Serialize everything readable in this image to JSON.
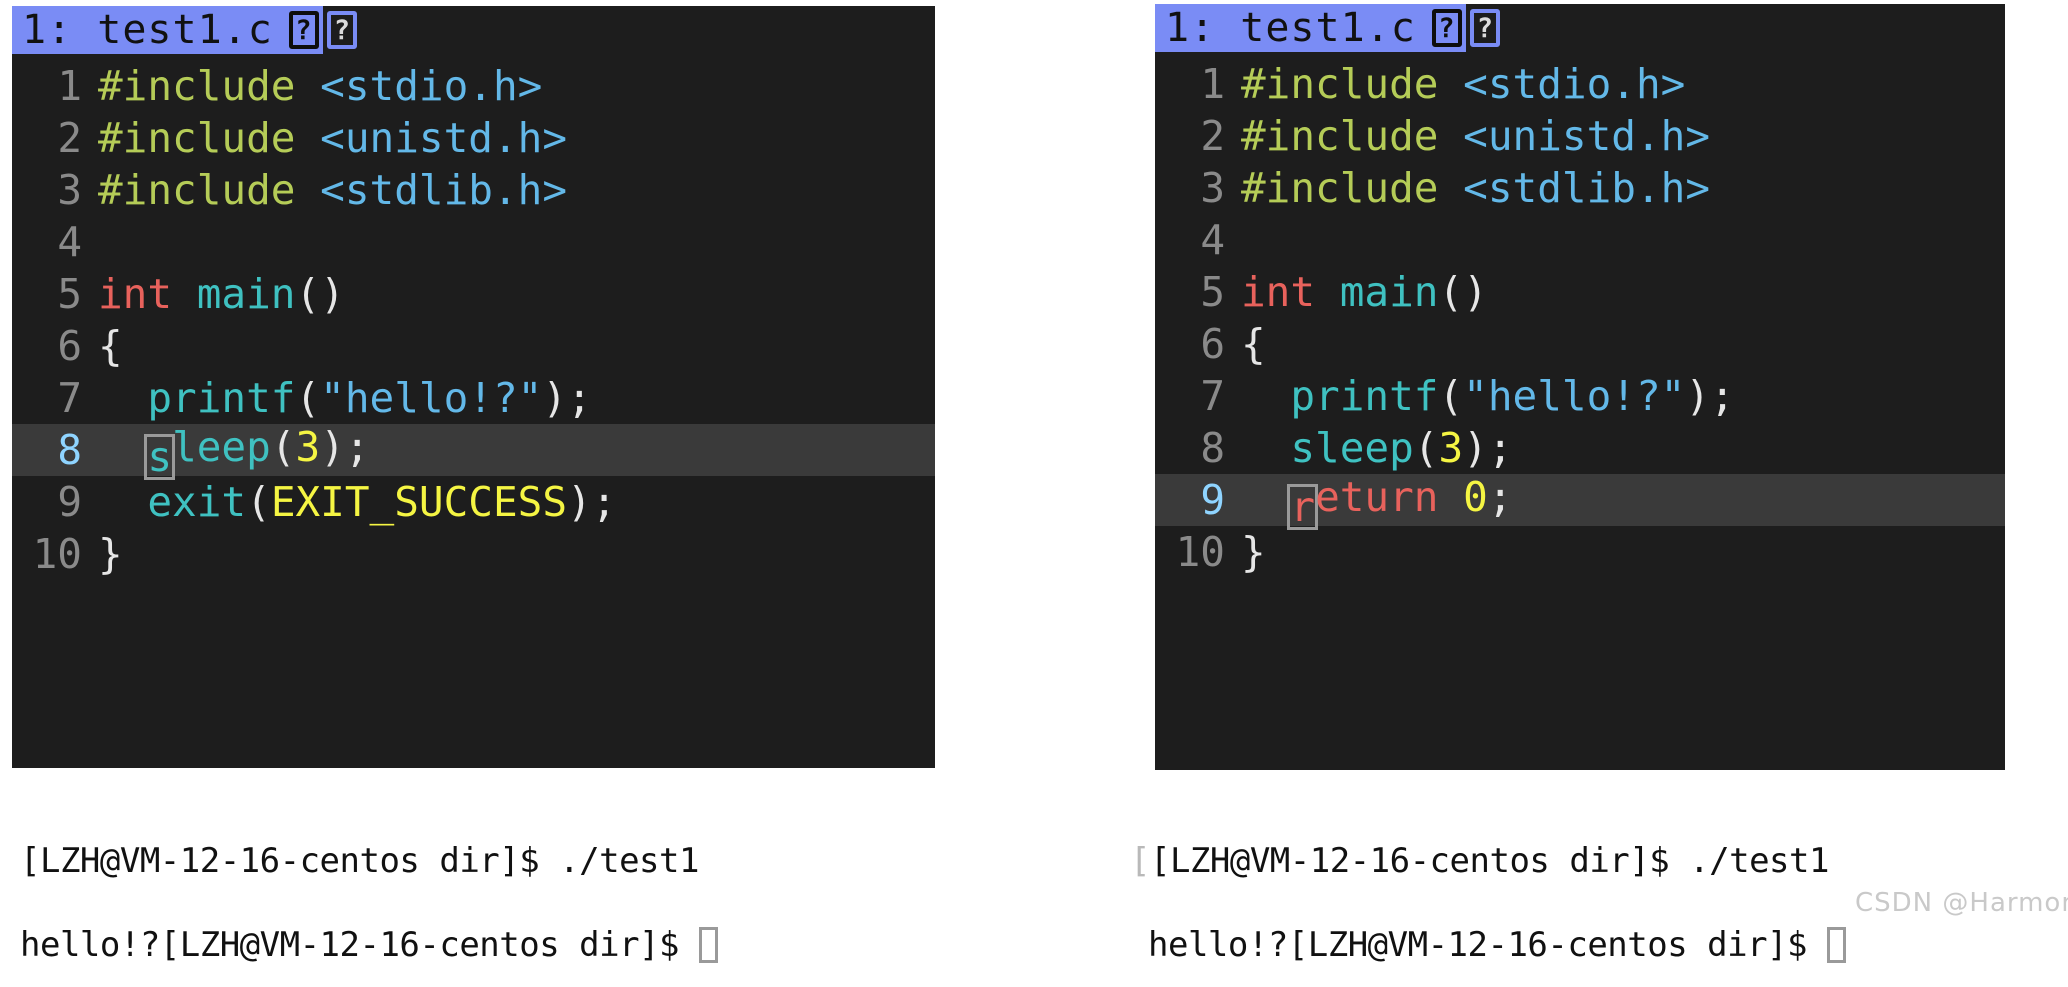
{
  "left_panel": {
    "tab": {
      "label": "1: test1.c",
      "help_icon_1": "?",
      "help_icon_2": "?",
      "active_color": "#7a8cf5"
    },
    "current_line": 8,
    "lines": [
      {
        "num": "1",
        "tokens": [
          {
            "t": "#include ",
            "c": "pre"
          },
          {
            "t": "<stdio.h>",
            "c": "str"
          }
        ]
      },
      {
        "num": "2",
        "tokens": [
          {
            "t": "#include ",
            "c": "pre"
          },
          {
            "t": "<unistd.h>",
            "c": "str"
          }
        ]
      },
      {
        "num": "3",
        "tokens": [
          {
            "t": "#include ",
            "c": "pre"
          },
          {
            "t": "<stdlib.h>",
            "c": "str"
          }
        ]
      },
      {
        "num": "4",
        "tokens": []
      },
      {
        "num": "5",
        "tokens": [
          {
            "t": "int ",
            "c": "kw"
          },
          {
            "t": "main",
            "c": "fn"
          },
          {
            "t": "()",
            "c": "plain"
          }
        ]
      },
      {
        "num": "6",
        "tokens": [
          {
            "t": "{",
            "c": "plain"
          }
        ]
      },
      {
        "num": "7",
        "tokens": [
          {
            "t": "  ",
            "c": "plain"
          },
          {
            "t": "printf",
            "c": "fn"
          },
          {
            "t": "(",
            "c": "plain"
          },
          {
            "t": "\"hello!?\"",
            "c": "str"
          },
          {
            "t": ");",
            "c": "plain"
          }
        ]
      },
      {
        "num": "8",
        "tokens": [
          {
            "t": "  ",
            "c": "plain"
          },
          {
            "t": "s",
            "c": "fn",
            "cursor": true
          },
          {
            "t": "leep",
            "c": "fn"
          },
          {
            "t": "(",
            "c": "plain"
          },
          {
            "t": "3",
            "c": "num"
          },
          {
            "t": ");",
            "c": "plain"
          }
        ]
      },
      {
        "num": "9",
        "tokens": [
          {
            "t": "  ",
            "c": "plain"
          },
          {
            "t": "exit",
            "c": "fn"
          },
          {
            "t": "(",
            "c": "plain"
          },
          {
            "t": "EXIT_SUCCESS",
            "c": "const"
          },
          {
            "t": ");",
            "c": "plain"
          }
        ]
      },
      {
        "num": "10",
        "tokens": [
          {
            "t": "}",
            "c": "plain"
          }
        ]
      }
    ],
    "terminal": {
      "lead_ghost": "",
      "line1": "[LZH@VM-12-16-centos dir]$ ./test1",
      "line2": "hello!?[LZH@VM-12-16-centos dir]$ "
    }
  },
  "right_panel": {
    "tab": {
      "label": "1: test1.c",
      "help_icon_1": "?",
      "help_icon_2": "?",
      "active_color": "#7a8cf5"
    },
    "current_line": 9,
    "lines": [
      {
        "num": "1",
        "tokens": [
          {
            "t": "#include ",
            "c": "pre"
          },
          {
            "t": "<stdio.h>",
            "c": "str"
          }
        ]
      },
      {
        "num": "2",
        "tokens": [
          {
            "t": "#include ",
            "c": "pre"
          },
          {
            "t": "<unistd.h>",
            "c": "str"
          }
        ]
      },
      {
        "num": "3",
        "tokens": [
          {
            "t": "#include ",
            "c": "pre"
          },
          {
            "t": "<stdlib.h>",
            "c": "str"
          }
        ]
      },
      {
        "num": "4",
        "tokens": []
      },
      {
        "num": "5",
        "tokens": [
          {
            "t": "int ",
            "c": "kw"
          },
          {
            "t": "main",
            "c": "fn"
          },
          {
            "t": "()",
            "c": "plain"
          }
        ]
      },
      {
        "num": "6",
        "tokens": [
          {
            "t": "{",
            "c": "plain"
          }
        ]
      },
      {
        "num": "7",
        "tokens": [
          {
            "t": "  ",
            "c": "plain"
          },
          {
            "t": "printf",
            "c": "fn"
          },
          {
            "t": "(",
            "c": "plain"
          },
          {
            "t": "\"hello!?\"",
            "c": "str"
          },
          {
            "t": ");",
            "c": "plain"
          }
        ]
      },
      {
        "num": "8",
        "tokens": [
          {
            "t": "  ",
            "c": "plain"
          },
          {
            "t": "sleep",
            "c": "fn"
          },
          {
            "t": "(",
            "c": "plain"
          },
          {
            "t": "3",
            "c": "num"
          },
          {
            "t": ");",
            "c": "plain"
          }
        ]
      },
      {
        "num": "9",
        "tokens": [
          {
            "t": "  ",
            "c": "plain"
          },
          {
            "t": "r",
            "c": "kw",
            "cursor": true
          },
          {
            "t": "eturn ",
            "c": "kw"
          },
          {
            "t": "0",
            "c": "num"
          },
          {
            "t": ";",
            "c": "plain"
          }
        ]
      },
      {
        "num": "10",
        "tokens": [
          {
            "t": "}",
            "c": "plain"
          }
        ]
      }
    ],
    "terminal": {
      "lead_ghost": "[",
      "line1": "[LZH@VM-12-16-centos dir]$ ./test1",
      "line2": "hello!?[LZH@VM-12-16-centos dir]$ "
    }
  },
  "watermark": {
    "text": "CSDN @Harmonic_Law"
  }
}
